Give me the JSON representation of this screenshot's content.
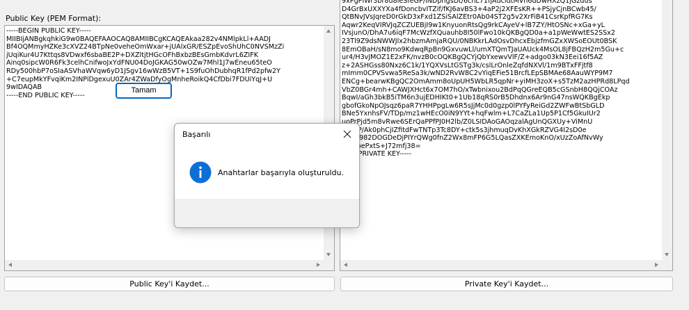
{
  "public_key": {
    "label": "Public Key (PEM Format):",
    "text": "-----BEGIN PUBLIC KEY-----\nMIIBIjANBgkqhkiG9w0BAQEFAAOCAQ8AMIIBCgKCAQEAkaa282v4NMlpkLl+AADJ\nBf4OQMmyHZKe3cXVZ24BTpNe0veheOmWxar+jUAlxGR/ESZpEvoShUhC0NVSMzZi\njUqiKur4U7Kttqs8VDwxf6sbaBE2P+DXZltjtHGcOFhBxbzBEsGmbKdvrL6ZIFK\nAinq0sipcW0R6Fk3celhCnifwoJxYdFNU04DoJGKAG50wOZw7Mhl1J7wEneu65teO\nRDy500hbP7oSIaASVhaWVqw6yD1JSgv16wWzB5VT+1S9fuOhDubhqR1fPd2pfw2Y\n+C7eupMkYFvqiKm2INPiDgexuU0ZAr4ZWaDfyOgMnheRoikQ4CfDbi7FDUiYqJ+U\n9wIDAQAB\n-----END PUBLIC KEY-----",
    "save_label": "Public Key'i Kaydet..."
  },
  "private_key": {
    "text": "9xPgPIWr3br8u8leSfeGP/iNDphgsDt/6chL71fjAucidtMVh6dDwHXzQ1jGzdus\nD4GrBxUXXYXa4fDoncbvITZif/fKJ6avBS3+4aP2j2XFEsKR++PSjyCjnBCwb45/\nQtBNvJVsJqreD0rGkD3xFxd1ZSiSAlZEtr0Ab04ST2g5v2XrFiB41CsrKpfRG7Ks\nAqwr2KeqVIRVJqZCZUEBjI9w1KnyuonRtsQg9rkCAyeV+lB7ZY/HtOSNc+xGa+yL\nIVsjunO/DhA7u6iqF7McWzfXQuauhb8I50lFwo10kQKBgQD0a+a1pWeWwtES2SSx2\n23Tl9Z9dsNWWJlx2hbzmAmjaRQU/0NBKkrLAdOsvDhcxEbjzfmGZxXWSoEOUt0BSK\n8EmOBaH/sN8mo9KdwqRpBn9GxvuwLl/umXTQmTJaUAUck4MsOL8jFBQzH2m5Gu+c\nur4/H3vJMOZ1E2xFK/nvzB0cOQKBgQCYjQbYxewvVlF/Z+adgo03kN3Eei16f5AZ\nz+2ASHGss80Nxz6C1k/1YQXVsLtGSTg3k/cslLrOnleZqfdNXVl/1m9BTxFFjtf8\nmImm0CPVSvwa5ReSa3k/wND2RvW8C2vYiqEFie51BrcfLEpSBMAe68AauWYP9M7\nENCg+bearwKBgQC2OmAmm8oUpUH5WbLR5qpNr+yiMH3zoX+s5TzM2azHPRd8LPqd\nVbZ0BGr4mh+CAWJXHct6x7OM7hO/xTwbnixou2BdPqQGreEQB5cGSnbH8QQjCOAz\nBqwI/aGh3bkB5iTM6n3ujEDHIKt0+1Ub18qRS0rB5Dhdnx6Ar9nG47nsWQKBgEkp\ngbofGkoNpOJsqz6paR7YHHPpgLw6R5sJjMc0d0gzp0lPYFyReiGd2ZWFwBtSbGLD\nBNe5YxnhsFV/TDp/mz1wHEcO0iN9YYt+hqFwlm+L7CaZLa1Up5P1Cf5GkuIUr2\nuoPrPjd5m8vRwe6SErQaPPfPJ0H2lb/Z0LSIDAoGAOqzalAgUnQGXUy+ViMnU\nsepeP/Ak0phCjIZfitdFwTNTp3Tc8DY+ctk5s3jhmuqDvKhXGkRZVG4I2sD0e\nL5Op982DOGDeDjPIYrQWg0fnZ2Wx8mFP6G5LQasZXKEmoKnO/xUzZoAfNvWy\nu1f1pePxtS+J72mfj38=\nEND PRIVATE KEY-----",
    "save_label": "Private Key'i Kaydet..."
  },
  "dialog": {
    "title": "Başarılı",
    "message": "Anahtarlar başarıyla oluşturuldu.",
    "ok_label": "Tamam",
    "icon": "info-icon",
    "close_icon": "close-icon"
  },
  "colors": {
    "accent": "#0067c0",
    "info_icon": "#0d6fd6",
    "window_bg": "#f0f0f0"
  }
}
